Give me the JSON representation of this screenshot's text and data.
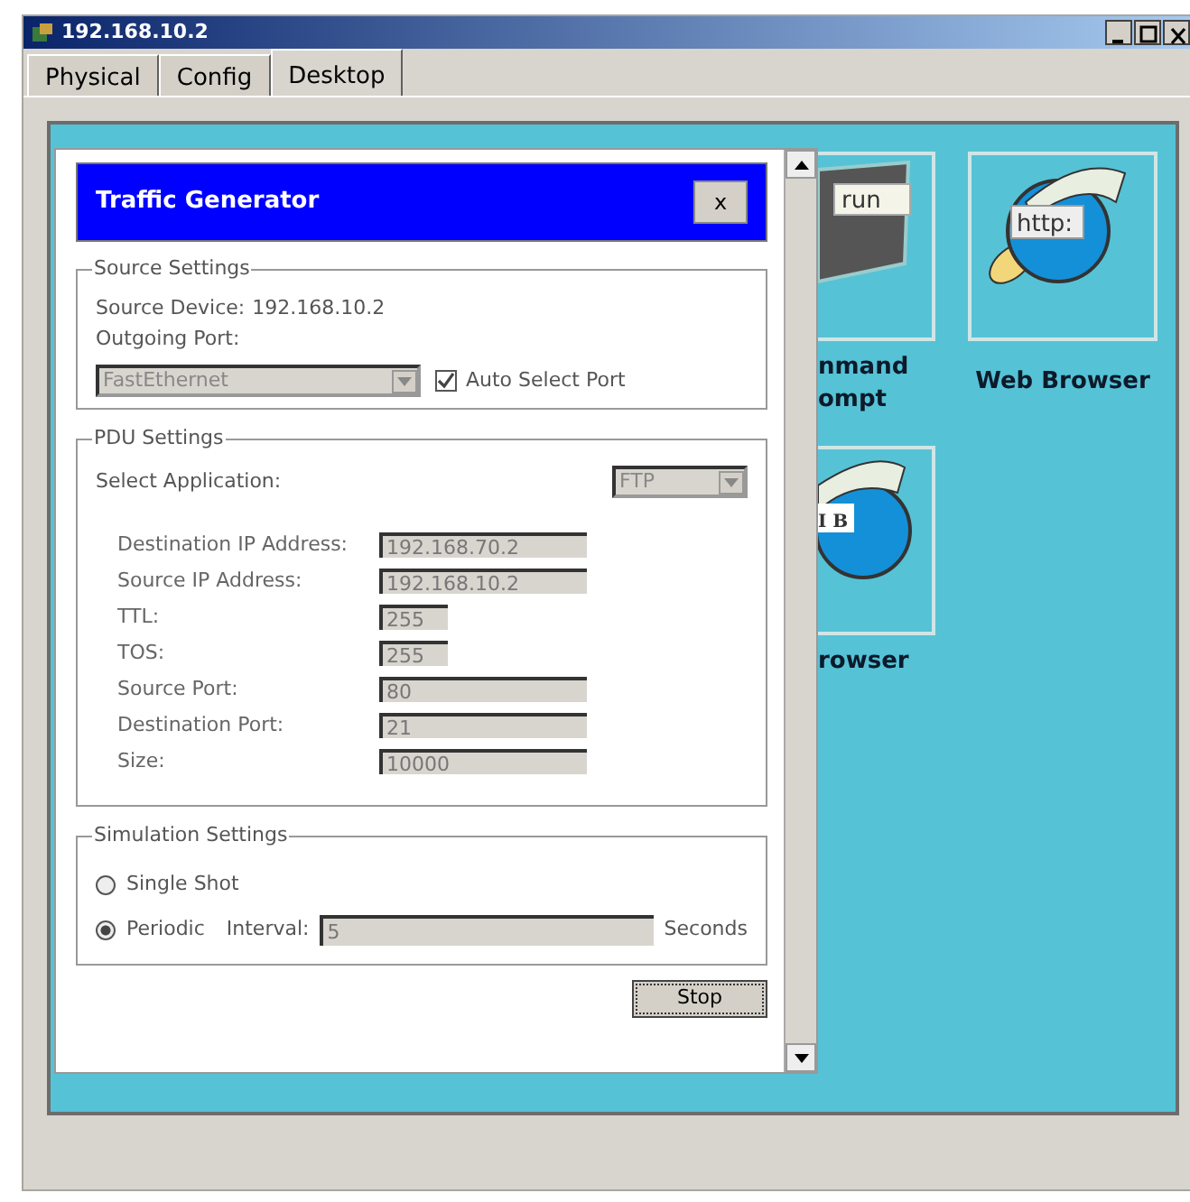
{
  "window": {
    "title": "192.168.10.2"
  },
  "tabs": [
    {
      "label": "Physical",
      "selected": false
    },
    {
      "label": "Config",
      "selected": false
    },
    {
      "label": "Desktop",
      "selected": true
    }
  ],
  "desktop_apps": [
    {
      "kind": "terminal",
      "icon_text": "run",
      "label_lines": [
        "nmand",
        "ompt"
      ]
    },
    {
      "kind": "browser",
      "icon_text": "http:",
      "label_lines": [
        "Web Browser"
      ]
    },
    {
      "kind": "mib",
      "icon_text": "I B",
      "label_lines": [
        "rowser"
      ]
    }
  ],
  "dialog": {
    "title": "Traffic Generator",
    "close": "x",
    "source_settings": {
      "legend": "Source Settings",
      "source_device_label": "Source Device:",
      "source_device": "192.168.10.2",
      "outgoing_port_label": "Outgoing Port:",
      "port_select": {
        "value": "FastEthernet",
        "disabled": true
      },
      "auto_select": {
        "label": "Auto Select Port",
        "checked": true
      }
    },
    "pdu_settings": {
      "legend": "PDU Settings",
      "application_label": "Select Application:",
      "application": {
        "value": "FTP",
        "disabled": true
      },
      "fields": [
        {
          "label": "Destination IP Address:",
          "value": "192.168.70.2",
          "kind": "long"
        },
        {
          "label": "Source IP Address:",
          "value": "192.168.10.2",
          "kind": "long"
        },
        {
          "label": "TTL:",
          "value": "255",
          "kind": "short"
        },
        {
          "label": "TOS:",
          "value": "255",
          "kind": "short"
        },
        {
          "label": "Source Port:",
          "value": "80",
          "kind": "long"
        },
        {
          "label": "Destination Port:",
          "value": "21",
          "kind": "long"
        },
        {
          "label": "Size:",
          "value": "10000",
          "kind": "long"
        }
      ]
    },
    "simulation_settings": {
      "legend": "Simulation Settings",
      "modes": [
        {
          "label": "Single Shot",
          "selected": false
        },
        {
          "label": "Periodic",
          "selected": true
        }
      ],
      "interval_label": "Interval:",
      "interval": "5",
      "unit": "Seconds"
    },
    "button": "Stop"
  }
}
